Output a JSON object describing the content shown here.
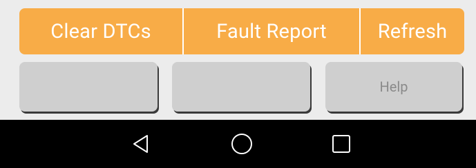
{
  "toolbar": {
    "clear_dtcs_label": "Clear DTCs",
    "fault_report_label": "Fault Report",
    "refresh_label": "Refresh"
  },
  "secondary_buttons": {
    "button1_label": "",
    "button2_label": "",
    "help_label": "Help"
  },
  "navbar": {
    "icons": [
      "back-icon",
      "home-icon",
      "recents-icon"
    ]
  },
  "colors": {
    "accent": "#f8ac47",
    "button_gray": "#cfcfcf",
    "background": "#ececec",
    "navbar": "#000000"
  }
}
